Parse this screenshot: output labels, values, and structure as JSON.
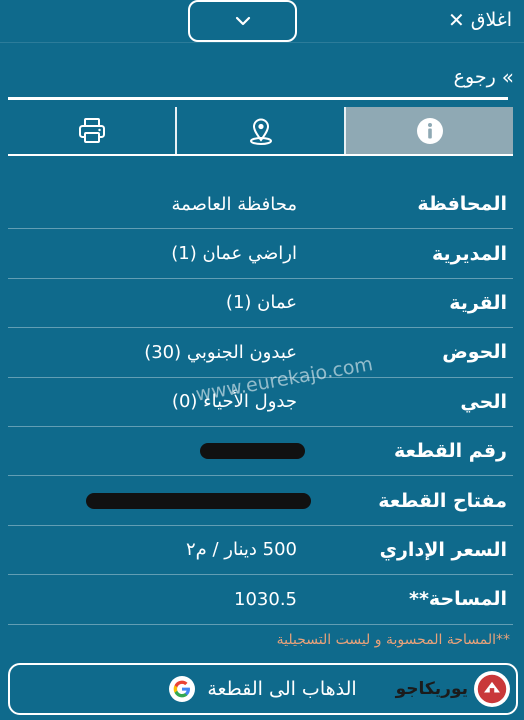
{
  "topbar": {
    "close_label": "اغلاق",
    "close_icon": "x-icon",
    "collapse_icon": "chevron-down-icon"
  },
  "nav": {
    "back_label": "رجوع",
    "back_icon": "double-chevron-icon"
  },
  "tabs": [
    {
      "name": "print",
      "icon": "printer-icon",
      "active": false
    },
    {
      "name": "location",
      "icon": "map-pin-icon",
      "active": false
    },
    {
      "name": "info",
      "icon": "info-icon",
      "active": true
    }
  ],
  "details": [
    {
      "label": "المحافظة",
      "value": "محافظة العاصمة"
    },
    {
      "label": "المديرية",
      "value": "اراضي عمان (1)"
    },
    {
      "label": "القرية",
      "value": "عمان (1)"
    },
    {
      "label": "الحوض",
      "value": "عبدون الجنوبي (30)"
    },
    {
      "label": "الحي",
      "value": "جدول الأحياء (0)"
    },
    {
      "label": "رقم القطعة",
      "value": ""
    },
    {
      "label": "مفتاح القطعة",
      "value": ""
    },
    {
      "label": "السعر الإداري",
      "value": "500 دينار / م٢"
    },
    {
      "label": "المساحة**",
      "value": "1030.5"
    }
  ],
  "watermark": "www.eurekajo.com",
  "note": "**المساحة المحسوبة و ليست التسجيلية",
  "goto_button": {
    "label": "الذهاب الى القطعة",
    "icon": "google-g-icon"
  },
  "brand": {
    "text": "يوريكاجو",
    "icon": "eurekajo-logo-icon"
  },
  "colors": {
    "background": "#0f6a8c",
    "active_tab": "#8fa9b4",
    "note": "#e8a27a",
    "redaction": "#111111"
  }
}
